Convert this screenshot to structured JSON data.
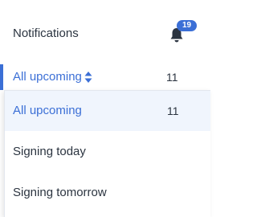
{
  "header": {
    "title": "Notifications",
    "bell_icon": "bell-icon",
    "badge_count": "19"
  },
  "filter": {
    "selected_label": "All upcoming",
    "selected_count": "11",
    "sort_icon": "sort-icon"
  },
  "dropdown": {
    "options": [
      {
        "label": "All upcoming",
        "count": "11",
        "selected": true
      },
      {
        "label": "Signing today",
        "count": ""
      },
      {
        "label": "Signing tomorrow",
        "count": ""
      }
    ]
  },
  "colors": {
    "accent": "#3b6fd6",
    "selected_bg": "#f0f5fd",
    "text": "#2b3440"
  }
}
